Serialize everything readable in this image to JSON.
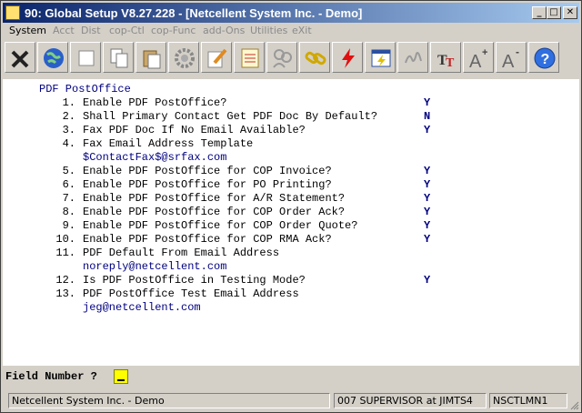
{
  "window": {
    "title": "90: Global Setup V8.27.228 - [Netcellent System Inc. - Demo]",
    "min_glyph": "_",
    "max_glyph": "□",
    "close_glyph": "✕"
  },
  "menu": [
    "System",
    "Acct",
    "Dist",
    "cop-Ctl",
    "cop-Func",
    "add-Ons",
    "Utilities",
    "eXit"
  ],
  "console": {
    "section_title": "PDF PostOffice",
    "items": [
      {
        "num": "1.",
        "label": "Enable PDF PostOffice?",
        "answer": "Y"
      },
      {
        "num": "2.",
        "label": "Shall Primary Contact Get PDF Doc By Default?",
        "answer": "N"
      },
      {
        "num": "3.",
        "label": "Fax PDF Doc If No Email Available?",
        "answer": "Y"
      },
      {
        "num": "4.",
        "label": "Fax Email Address Template",
        "value": "$ContactFax$@srfax.com"
      },
      {
        "num": "5.",
        "label": "Enable PDF PostOffice for COP Invoice?",
        "answer": "Y"
      },
      {
        "num": "6.",
        "label": "Enable PDF PostOffice for PO Printing?",
        "answer": "Y"
      },
      {
        "num": "7.",
        "label": "Enable PDF PostOffice for A/R Statement?",
        "answer": "Y"
      },
      {
        "num": "8.",
        "label": "Enable PDF PostOffice for COP Order Ack?",
        "answer": "Y"
      },
      {
        "num": "9.",
        "label": "Enable PDF PostOffice for COP Order Quote?",
        "answer": "Y"
      },
      {
        "num": "10.",
        "label": "Enable PDF PostOffice for COP RMA Ack?",
        "answer": "Y"
      },
      {
        "num": "11.",
        "label": "PDF Default From Email Address",
        "value": "noreply@netcellent.com"
      },
      {
        "num": "12.",
        "label": "Is PDF PostOffice in Testing Mode?",
        "answer": "Y"
      },
      {
        "num": "13.",
        "label": "PDF PostOffice Test Email Address",
        "value": "jeg@netcellent.com"
      }
    ]
  },
  "prompt": {
    "label": "Field Number ?"
  },
  "status": {
    "company": "Netcellent System Inc. - Demo",
    "user": "007 SUPERVISOR at JIMTS4",
    "machine": "NSCTLMN1"
  },
  "toolbar_icons": [
    "close-x-icon",
    "globe-icon",
    "blank-window-icon",
    "copy-icon",
    "paste-icon",
    "settings-gear-icon",
    "edit-pencil-icon",
    "notepad-icon",
    "users-icon",
    "link-icon",
    "lightning-icon",
    "window-lightning-icon",
    "signature-icon",
    "font-tt-icon",
    "font-grow-icon",
    "font-shrink-icon",
    "help-icon"
  ]
}
